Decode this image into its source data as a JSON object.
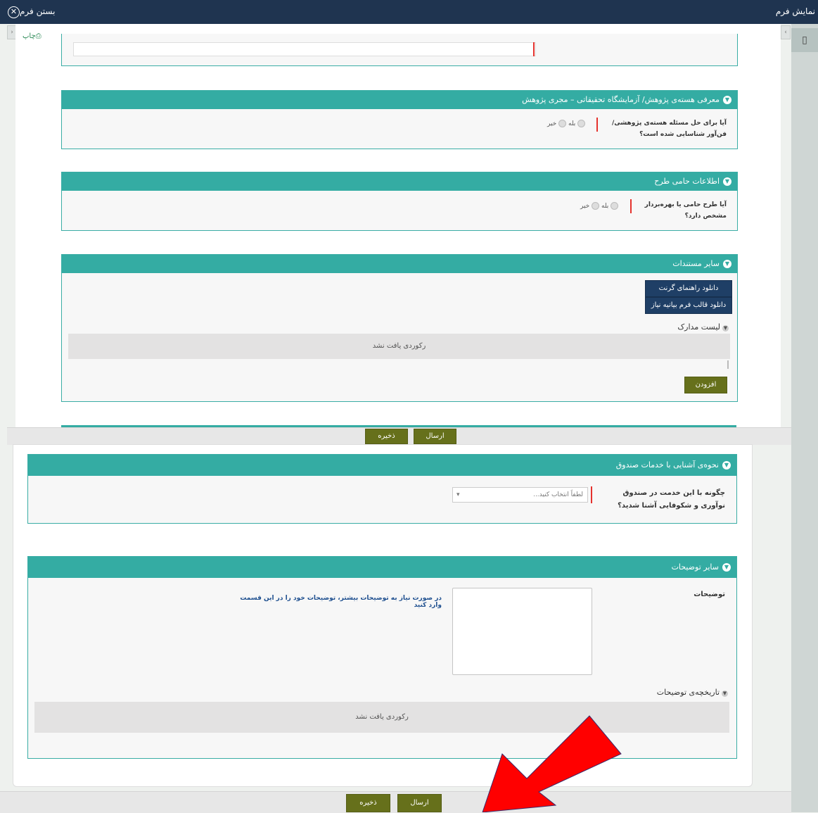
{
  "window": {
    "title": "نمایش فرم",
    "close_label": "بستن فرم"
  },
  "toolbar": {
    "print_label": "چاپ"
  },
  "panels": {
    "research_intro": {
      "title": "معرفی هسته‌ی پژوهش/ آزمایشگاه تحقیقاتی – مجری پژوهش",
      "question": "آیا برای حل مسئله هسته‌ی پژوهشی/ فن‌آور شناسایی شده است؟",
      "options": [
        "بله",
        "خیر"
      ]
    },
    "sponsor": {
      "title": "اطلاعات حامی طرح",
      "question": "آیا طرح حامی یا بهره‌بردار مشخص دارد؟",
      "options": [
        "بله",
        "خیر"
      ]
    },
    "other_docs": {
      "title": "سایر مستندات",
      "download_grant_guide": "دانلود راهنمای گرنت",
      "download_needs_template": "دانلود قالب فرم بیانیه نیاز",
      "docs_list_label": "لیست مدارک",
      "no_record": "رکوردی یافت نشد",
      "add_button": "افزودن"
    },
    "familiarity": {
      "title": "نحوه‌ی آشنایی با خدمات صندوق",
      "question": "چگونه با این خدمت در صندوق نوآوری و شکوفایی آشنا شدید؟",
      "select_placeholder": "لطفاً انتخاب کنید...",
      "select_arrow": "▾"
    },
    "other_comments": {
      "title": "سایر توضیحات",
      "field_label": "توضیحات",
      "hint": "در صورت نیاز به توضیحات بیشتر، توضیحات خود را در این قسمت وارد کنید",
      "history_label": "تاریخچه‌ی توضیحات",
      "no_record": "رکوردی یافت نشد"
    }
  },
  "footer": {
    "send_label": "ارسال",
    "save_label": "ذخیره"
  },
  "colors": {
    "header": "#1f3450",
    "panel_header": "#34aca3",
    "button_olive": "#66701b",
    "button_navy": "#1f3f66",
    "required": "#e5322d",
    "arrow": "#ff0000"
  }
}
